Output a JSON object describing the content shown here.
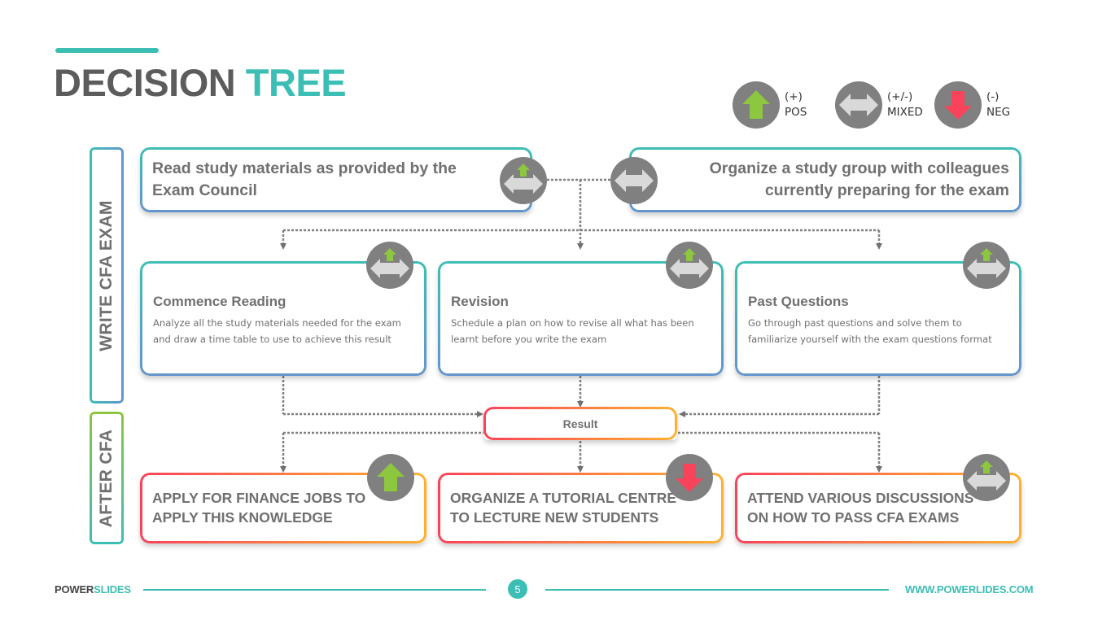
{
  "title": {
    "part1": "DECISION",
    "part2": "TREE"
  },
  "colors": {
    "accent": "#3dbeb4",
    "positive": "#8dc63f",
    "negative": "#f9435a",
    "neutral": "#d9d9d9",
    "badge_bg": "#808080",
    "warm_start": "#f9435a",
    "warm_end": "#ffb02e",
    "blue_end": "#6495cd"
  },
  "legend": [
    {
      "icon": "arrow-up-icon",
      "symbol": "(+)",
      "label": "POS"
    },
    {
      "icon": "arrow-left-right-icon",
      "symbol": "(+/-)",
      "label": "MIXED"
    },
    {
      "icon": "arrow-down-icon",
      "symbol": "(-)",
      "label": "NEG"
    }
  ],
  "sections": {
    "write": "WRITE CFA EXAM",
    "after": "AFTER CFA"
  },
  "top_options": [
    {
      "text": "Read study materials as provided by the Exam Council",
      "line1": "Read study materials as provided by the",
      "line2": "Exam Council",
      "rating": "mixed-positive"
    },
    {
      "text": "Organize a study group with colleagues currently preparing for the exam",
      "line1": "Organize a study group with colleagues",
      "line2": "currently preparing for the exam",
      "rating": "mixed"
    }
  ],
  "steps": [
    {
      "title": "Commence Reading",
      "description": "Analyze all the study materials needed for the exam and draw a time table to use to achieve this result",
      "rating": "mixed-positive"
    },
    {
      "title": "Revision",
      "description": "Schedule a plan on how to revise all what has been learnt before you write the exam",
      "rating": "mixed-positive"
    },
    {
      "title": "Past Questions",
      "description": "Go through past questions and solve them to familiarize yourself with the exam questions format",
      "rating": "mixed-positive"
    }
  ],
  "result": {
    "label": "Result"
  },
  "outcomes": [
    {
      "line1": "APPLY FOR FINANCE JOBS TO",
      "line2": "APPLY THIS KNOWLEDGE",
      "rating": "positive"
    },
    {
      "line1": "ORGANIZE A TUTORIAL CENTRE",
      "line2": "TO LECTURE NEW STUDENTS",
      "rating": "negative"
    },
    {
      "line1": "ATTEND VARIOUS DISCUSSIONS",
      "line2": "ON HOW TO PASS CFA EXAMS",
      "rating": "mixed-positive"
    }
  ],
  "footer": {
    "brand_part1": "POWER",
    "brand_part2": "SLIDES",
    "page_number": "5",
    "url": "WWW.POWERLIDES.COM"
  }
}
